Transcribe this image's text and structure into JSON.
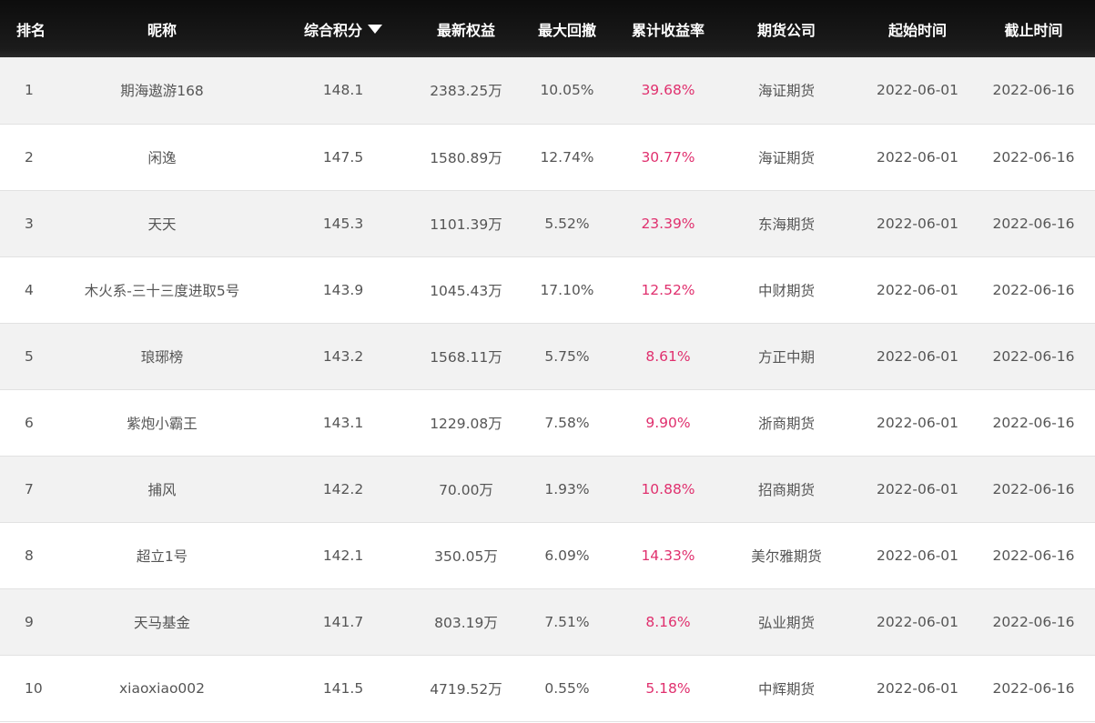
{
  "table": {
    "headers": {
      "rank": "排名",
      "nickname": "昵称",
      "score": "综合积分",
      "equity": "最新权益",
      "drawdown": "最大回撤",
      "return": "累计收益率",
      "company": "期货公司",
      "start": "起始时间",
      "end": "截止时间"
    },
    "sort_icon": "caret-down-icon",
    "colors": {
      "header_bg": "#111111",
      "header_text": "#ffffff",
      "row_odd": "#f2f2f2",
      "row_even": "#ffffff",
      "return_text": "#e0306e",
      "body_text": "#555555"
    },
    "rows": [
      {
        "rank": "1",
        "nickname": "期海遨游168",
        "score": "148.1",
        "equity": "2383.25万",
        "drawdown": "10.05%",
        "return": "39.68%",
        "company": "海证期货",
        "start": "2022-06-01",
        "end": "2022-06-16"
      },
      {
        "rank": "2",
        "nickname": "闲逸",
        "score": "147.5",
        "equity": "1580.89万",
        "drawdown": "12.74%",
        "return": "30.77%",
        "company": "海证期货",
        "start": "2022-06-01",
        "end": "2022-06-16"
      },
      {
        "rank": "3",
        "nickname": "天天",
        "score": "145.3",
        "equity": "1101.39万",
        "drawdown": "5.52%",
        "return": "23.39%",
        "company": "东海期货",
        "start": "2022-06-01",
        "end": "2022-06-16"
      },
      {
        "rank": "4",
        "nickname": "木火系-三十三度进取5号",
        "score": "143.9",
        "equity": "1045.43万",
        "drawdown": "17.10%",
        "return": "12.52%",
        "company": "中财期货",
        "start": "2022-06-01",
        "end": "2022-06-16"
      },
      {
        "rank": "5",
        "nickname": "琅琊榜",
        "score": "143.2",
        "equity": "1568.11万",
        "drawdown": "5.75%",
        "return": "8.61%",
        "company": "方正中期",
        "start": "2022-06-01",
        "end": "2022-06-16"
      },
      {
        "rank": "6",
        "nickname": "紫炮小霸王",
        "score": "143.1",
        "equity": "1229.08万",
        "drawdown": "7.58%",
        "return": "9.90%",
        "company": "浙商期货",
        "start": "2022-06-01",
        "end": "2022-06-16"
      },
      {
        "rank": "7",
        "nickname": "捕风",
        "score": "142.2",
        "equity": "70.00万",
        "drawdown": "1.93%",
        "return": "10.88%",
        "company": "招商期货",
        "start": "2022-06-01",
        "end": "2022-06-16"
      },
      {
        "rank": "8",
        "nickname": "超立1号",
        "score": "142.1",
        "equity": "350.05万",
        "drawdown": "6.09%",
        "return": "14.33%",
        "company": "美尔雅期货",
        "start": "2022-06-01",
        "end": "2022-06-16"
      },
      {
        "rank": "9",
        "nickname": "天马基金",
        "score": "141.7",
        "equity": "803.19万",
        "drawdown": "7.51%",
        "return": "8.16%",
        "company": "弘业期货",
        "start": "2022-06-01",
        "end": "2022-06-16"
      },
      {
        "rank": "10",
        "nickname": "xiaoxiao002",
        "score": "141.5",
        "equity": "4719.52万",
        "drawdown": "0.55%",
        "return": "5.18%",
        "company": "中辉期货",
        "start": "2022-06-01",
        "end": "2022-06-16"
      }
    ]
  }
}
